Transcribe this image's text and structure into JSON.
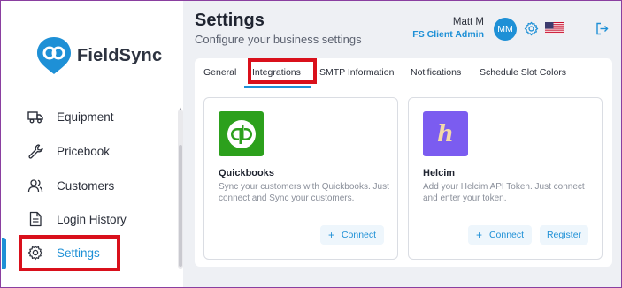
{
  "brand": {
    "name": "FieldSync",
    "color": "#1e90d6"
  },
  "sidebar": {
    "items": [
      {
        "label": "Equipment",
        "icon": "truck-icon"
      },
      {
        "label": "Pricebook",
        "icon": "wrench-icon"
      },
      {
        "label": "Customers",
        "icon": "users-icon"
      },
      {
        "label": "Login History",
        "icon": "document-icon"
      },
      {
        "label": "Settings",
        "icon": "gear-icon",
        "active": true
      }
    ]
  },
  "header": {
    "title": "Settings",
    "subtitle": "Configure your business settings",
    "user_name": "Matt M",
    "user_role": "FS Client Admin",
    "avatar_initials": "MM"
  },
  "tabs": [
    {
      "label": "General"
    },
    {
      "label": "Integrations",
      "active": true
    },
    {
      "label": "SMTP Information"
    },
    {
      "label": "Notifications"
    },
    {
      "label": "Schedule Slot Colors"
    }
  ],
  "integrations": [
    {
      "name": "Quickbooks",
      "description": "Sync your customers with Quickbooks. Just connect and Sync your customers.",
      "icon_color": "#2ca01c",
      "icon_glyph": "qb",
      "buttons": [
        {
          "label": "Connect",
          "plus": "+"
        }
      ]
    },
    {
      "name": "Helcim",
      "description": "Add your Helcim API Token. Just connect and enter your token.",
      "icon_color": "#7b5cf0",
      "icon_glyph": "h",
      "buttons": [
        {
          "label": "Connect",
          "plus": "+"
        },
        {
          "label": "Register"
        }
      ]
    }
  ]
}
